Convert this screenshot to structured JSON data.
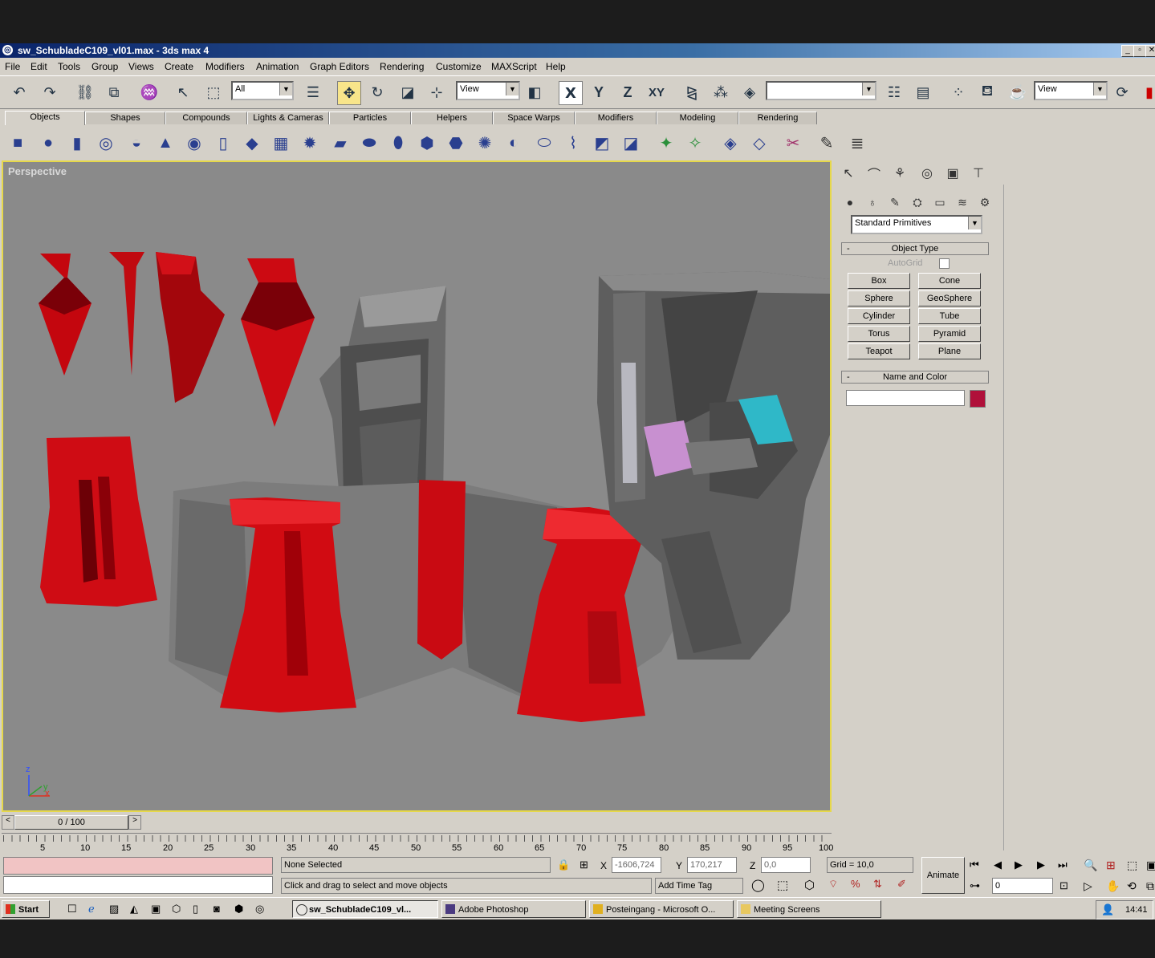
{
  "window": {
    "title": "sw_SchubladeC109_vl01.max - 3ds max 4",
    "min": "_",
    "max": "▫",
    "close": "✕"
  },
  "menu": [
    "File",
    "Edit",
    "Tools",
    "Group",
    "Views",
    "Create",
    "Modifiers",
    "Animation",
    "Graph Editors",
    "Rendering",
    "Customize",
    "MAXScript",
    "Help"
  ],
  "toolbar": {
    "selection_filter": "All",
    "ref_coord": "View",
    "axis_x": "X",
    "axis_y": "Y",
    "axis_z": "Z",
    "axis_xy": "XY",
    "named_sel": "",
    "render_view": "View"
  },
  "tabs": [
    "Objects",
    "Shapes",
    "Compounds",
    "Lights & Cameras",
    "Particles",
    "Helpers",
    "Space Warps",
    "Modifiers",
    "Modeling",
    "Rendering"
  ],
  "viewport": {
    "label": "Perspective",
    "axis_z": "z",
    "axis_x": "x",
    "axis_y": "y"
  },
  "command_panel": {
    "category": "Standard Primitives",
    "object_type_title": "Object Type",
    "autogrid": "AutoGrid",
    "buttons": [
      "Box",
      "Cone",
      "Sphere",
      "GeoSphere",
      "Cylinder",
      "Tube",
      "Torus",
      "Pyramid",
      "Teapot",
      "Plane"
    ],
    "name_color_title": "Name and Color",
    "name_value": "",
    "object_color": "#b0103a"
  },
  "timeline": {
    "slider_label": "0 / 100",
    "ticks": [
      "5",
      "10",
      "15",
      "20",
      "25",
      "30",
      "35",
      "40",
      "45",
      "50",
      "55",
      "60",
      "65",
      "70",
      "75",
      "80",
      "85",
      "90",
      "95",
      "100"
    ]
  },
  "status": {
    "selection": "None Selected",
    "prompt": "Click and drag to select and move objects",
    "x_label": "X",
    "x_value": "-1606,724",
    "y_label": "Y",
    "y_value": "170,217",
    "z_label": "Z",
    "z_value": "0,0",
    "grid": "Grid = 10,0",
    "add_time_tag": "Add Time Tag",
    "animate": "Animate",
    "frame": "0"
  },
  "taskbar": {
    "start": "Start",
    "tasks": [
      "sw_SchubladeC109_vl...",
      "Adobe Photoshop",
      "Posteingang - Microsoft O...",
      "Meeting Screens"
    ],
    "clock": "14:41"
  }
}
